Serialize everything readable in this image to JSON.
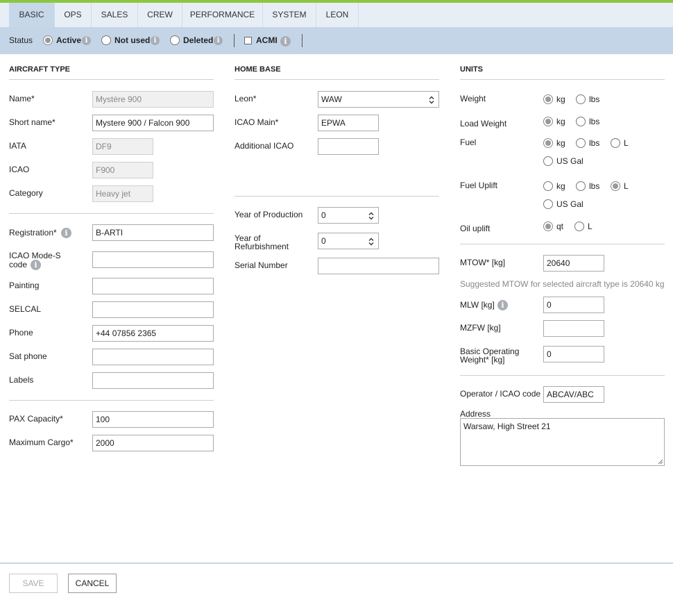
{
  "tabs": [
    {
      "label": "BASIC",
      "active": true
    },
    {
      "label": "OPS"
    },
    {
      "label": "SALES"
    },
    {
      "label": "CREW"
    },
    {
      "label": "PERFORMANCE"
    },
    {
      "label": "SYSTEM"
    },
    {
      "label": "LEON"
    }
  ],
  "status": {
    "label": "Status",
    "options": [
      {
        "label": "Active",
        "checked": true
      },
      {
        "label": "Not used"
      },
      {
        "label": "Deleted"
      }
    ],
    "acmi_label": "ACMI",
    "acmi_checked": false
  },
  "aircraft_type": {
    "title": "AIRCRAFT TYPE",
    "name_label": "Name*",
    "name_value": "Mystère 900",
    "short_name_label": "Short name*",
    "short_name_value": "Mystere 900  / Falcon 900",
    "iata_label": "IATA",
    "iata_value": "DF9",
    "icao_label": "ICAO",
    "icao_value": "F900",
    "category_label": "Category",
    "category_value": "Heavy jet"
  },
  "registration": {
    "registration_label": "Registration*",
    "registration_value": "B-ARTI",
    "mode_s_label_1": "ICAO Mode-S",
    "mode_s_label_2": "code",
    "mode_s_value": "",
    "painting_label": "Painting",
    "painting_value": "",
    "selcal_label": "SELCAL",
    "selcal_value": "",
    "phone_label": "Phone",
    "phone_value": "+44 07856 2365",
    "sat_phone_label": "Sat phone",
    "sat_phone_value": "",
    "labels_label": "Labels",
    "labels_value": ""
  },
  "capacity": {
    "pax_label": "PAX Capacity*",
    "pax_value": "100",
    "cargo_label": "Maximum Cargo*",
    "cargo_value": "2000"
  },
  "home_base": {
    "title": "HOME BASE",
    "leon_label": "Leon*",
    "leon_value": "WAW",
    "icao_main_label": "ICAO Main*",
    "icao_main_value": "EPWA",
    "additional_icao_label": "Additional ICAO",
    "additional_icao_value": "",
    "year_prod_label": "Year of Production",
    "year_prod_value": "0",
    "year_refurb_label_1": "Year of",
    "year_refurb_label_2": "Refurbishment",
    "year_refurb_value": "0",
    "serial_label": "Serial Number",
    "serial_value": ""
  },
  "units": {
    "title": "UNITS",
    "weight_label": "Weight",
    "load_weight_label": "Load Weight",
    "fuel_label": "Fuel",
    "fuel_uplift_label": "Fuel Uplift",
    "oil_uplift_label": "Oil uplift",
    "kg": "kg",
    "lbs": "lbs",
    "L": "L",
    "us_gal": "US Gal",
    "qt": "qt",
    "weight_selected": "kg",
    "load_weight_selected": "kg",
    "fuel_selected": "kg",
    "fuel_uplift_selected": "L",
    "oil_uplift_selected": "qt"
  },
  "weights": {
    "mtow_label": "MTOW* [kg]",
    "mtow_value": "20640",
    "mtow_hint": "Suggested MTOW for selected aircraft type is 20640 kg",
    "mlw_label": "MLW [kg]",
    "mlw_value": "0",
    "mzfw_label": "MZFW [kg]",
    "mzfw_value": "",
    "bow_label_1": "Basic Operating",
    "bow_label_2": "Weight* [kg]",
    "bow_value": "0"
  },
  "operator": {
    "operator_label": "Operator / ICAO code",
    "operator_value": "ABCAV/ABC",
    "address_label": "Address",
    "address_value": "Warsaw, High Street 21"
  },
  "footer": {
    "save_label": "SAVE",
    "cancel_label": "CANCEL"
  },
  "icons": {
    "info": "info-icon",
    "select": "chevron-updown-icon",
    "spinner": "spinner-arrows-icon",
    "resize": "resize-grip-icon"
  }
}
